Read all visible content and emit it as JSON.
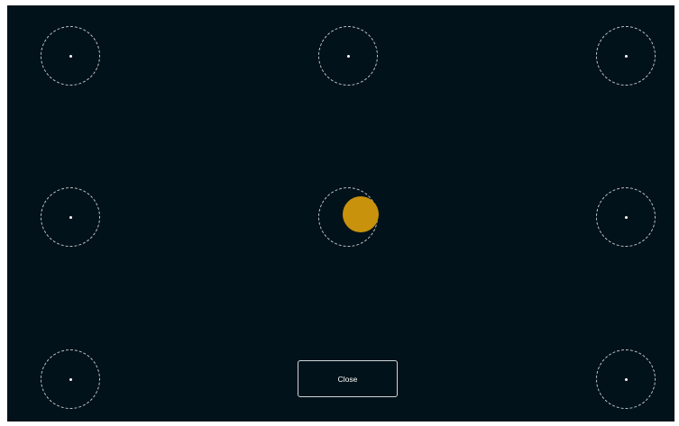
{
  "calibration": {
    "targets": [
      {
        "id": "top-left"
      },
      {
        "id": "top-center"
      },
      {
        "id": "top-right"
      },
      {
        "id": "middle-left"
      },
      {
        "id": "middle-center"
      },
      {
        "id": "middle-right"
      },
      {
        "id": "bottom-left"
      },
      {
        "id": "bottom-right"
      }
    ],
    "active_target": "middle-center"
  },
  "colors": {
    "background": "#02121a",
    "ring": "#ffffff",
    "active_marker": "#c8920c"
  },
  "buttons": {
    "close_label": "Close"
  }
}
